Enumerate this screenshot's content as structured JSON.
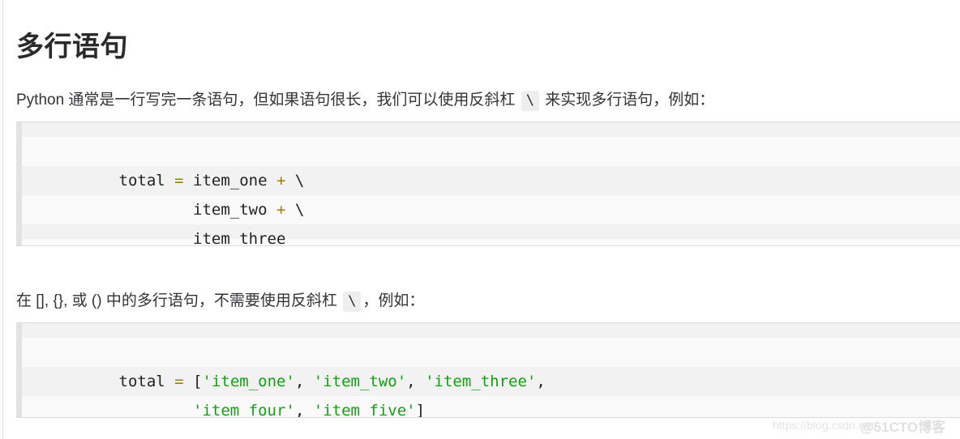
{
  "document": {
    "title": "多行语句",
    "paragraphs": [
      {
        "before_code": "Python 通常是一行写完一条语句，但如果语句很长，我们可以使用反斜杠 ",
        "code": "\\",
        "after_code": " 来实现多行语句，例如："
      },
      {
        "before_code": "在 [], {}, 或 () 中的多行语句，不需要使用反斜杠 ",
        "code": "\\",
        "after_code": "，例如："
      }
    ],
    "code_blocks": [
      {
        "language": "python",
        "lines": [
          {
            "tokens": [
              {
                "text": "total ",
                "type": "plain"
              },
              {
                "text": "=",
                "type": "operator"
              },
              {
                "text": " item_one ",
                "type": "plain"
              },
              {
                "text": "+",
                "type": "operator"
              },
              {
                "text": " \\",
                "type": "plain"
              }
            ]
          },
          {
            "tokens": [
              {
                "text": "        item_two ",
                "type": "plain"
              },
              {
                "text": "+",
                "type": "operator"
              },
              {
                "text": " \\",
                "type": "plain"
              }
            ]
          },
          {
            "tokens": [
              {
                "text": "        item_three",
                "type": "plain"
              }
            ]
          }
        ]
      },
      {
        "language": "python",
        "lines": [
          {
            "tokens": [
              {
                "text": "total ",
                "type": "plain"
              },
              {
                "text": "=",
                "type": "operator"
              },
              {
                "text": " [",
                "type": "plain"
              },
              {
                "text": "'item_one'",
                "type": "string"
              },
              {
                "text": ", ",
                "type": "plain"
              },
              {
                "text": "'item_two'",
                "type": "string"
              },
              {
                "text": ", ",
                "type": "plain"
              },
              {
                "text": "'item_three'",
                "type": "string"
              },
              {
                "text": ",",
                "type": "plain"
              }
            ]
          },
          {
            "tokens": [
              {
                "text": "        ",
                "type": "plain"
              },
              {
                "text": "'item_four'",
                "type": "string"
              },
              {
                "text": ", ",
                "type": "plain"
              },
              {
                "text": "'item_five'",
                "type": "string"
              },
              {
                "text": "]",
                "type": "plain"
              }
            ]
          }
        ]
      }
    ]
  },
  "watermarks": {
    "url": "https://blog.csdn.net/",
    "brand": "@51CTO博客"
  },
  "colors": {
    "heading": "#2b2b2b",
    "body_text": "#33333a",
    "code_text": "#222222",
    "operator": "#9a7d0a",
    "string": "#11a111",
    "code_bg_light": "#fafafa",
    "code_bg_stripe": "#f2f2f2",
    "gutter": "#e2e2e2",
    "inline_code_bg": "#eeeeee",
    "watermark": "#e3e3e3"
  }
}
